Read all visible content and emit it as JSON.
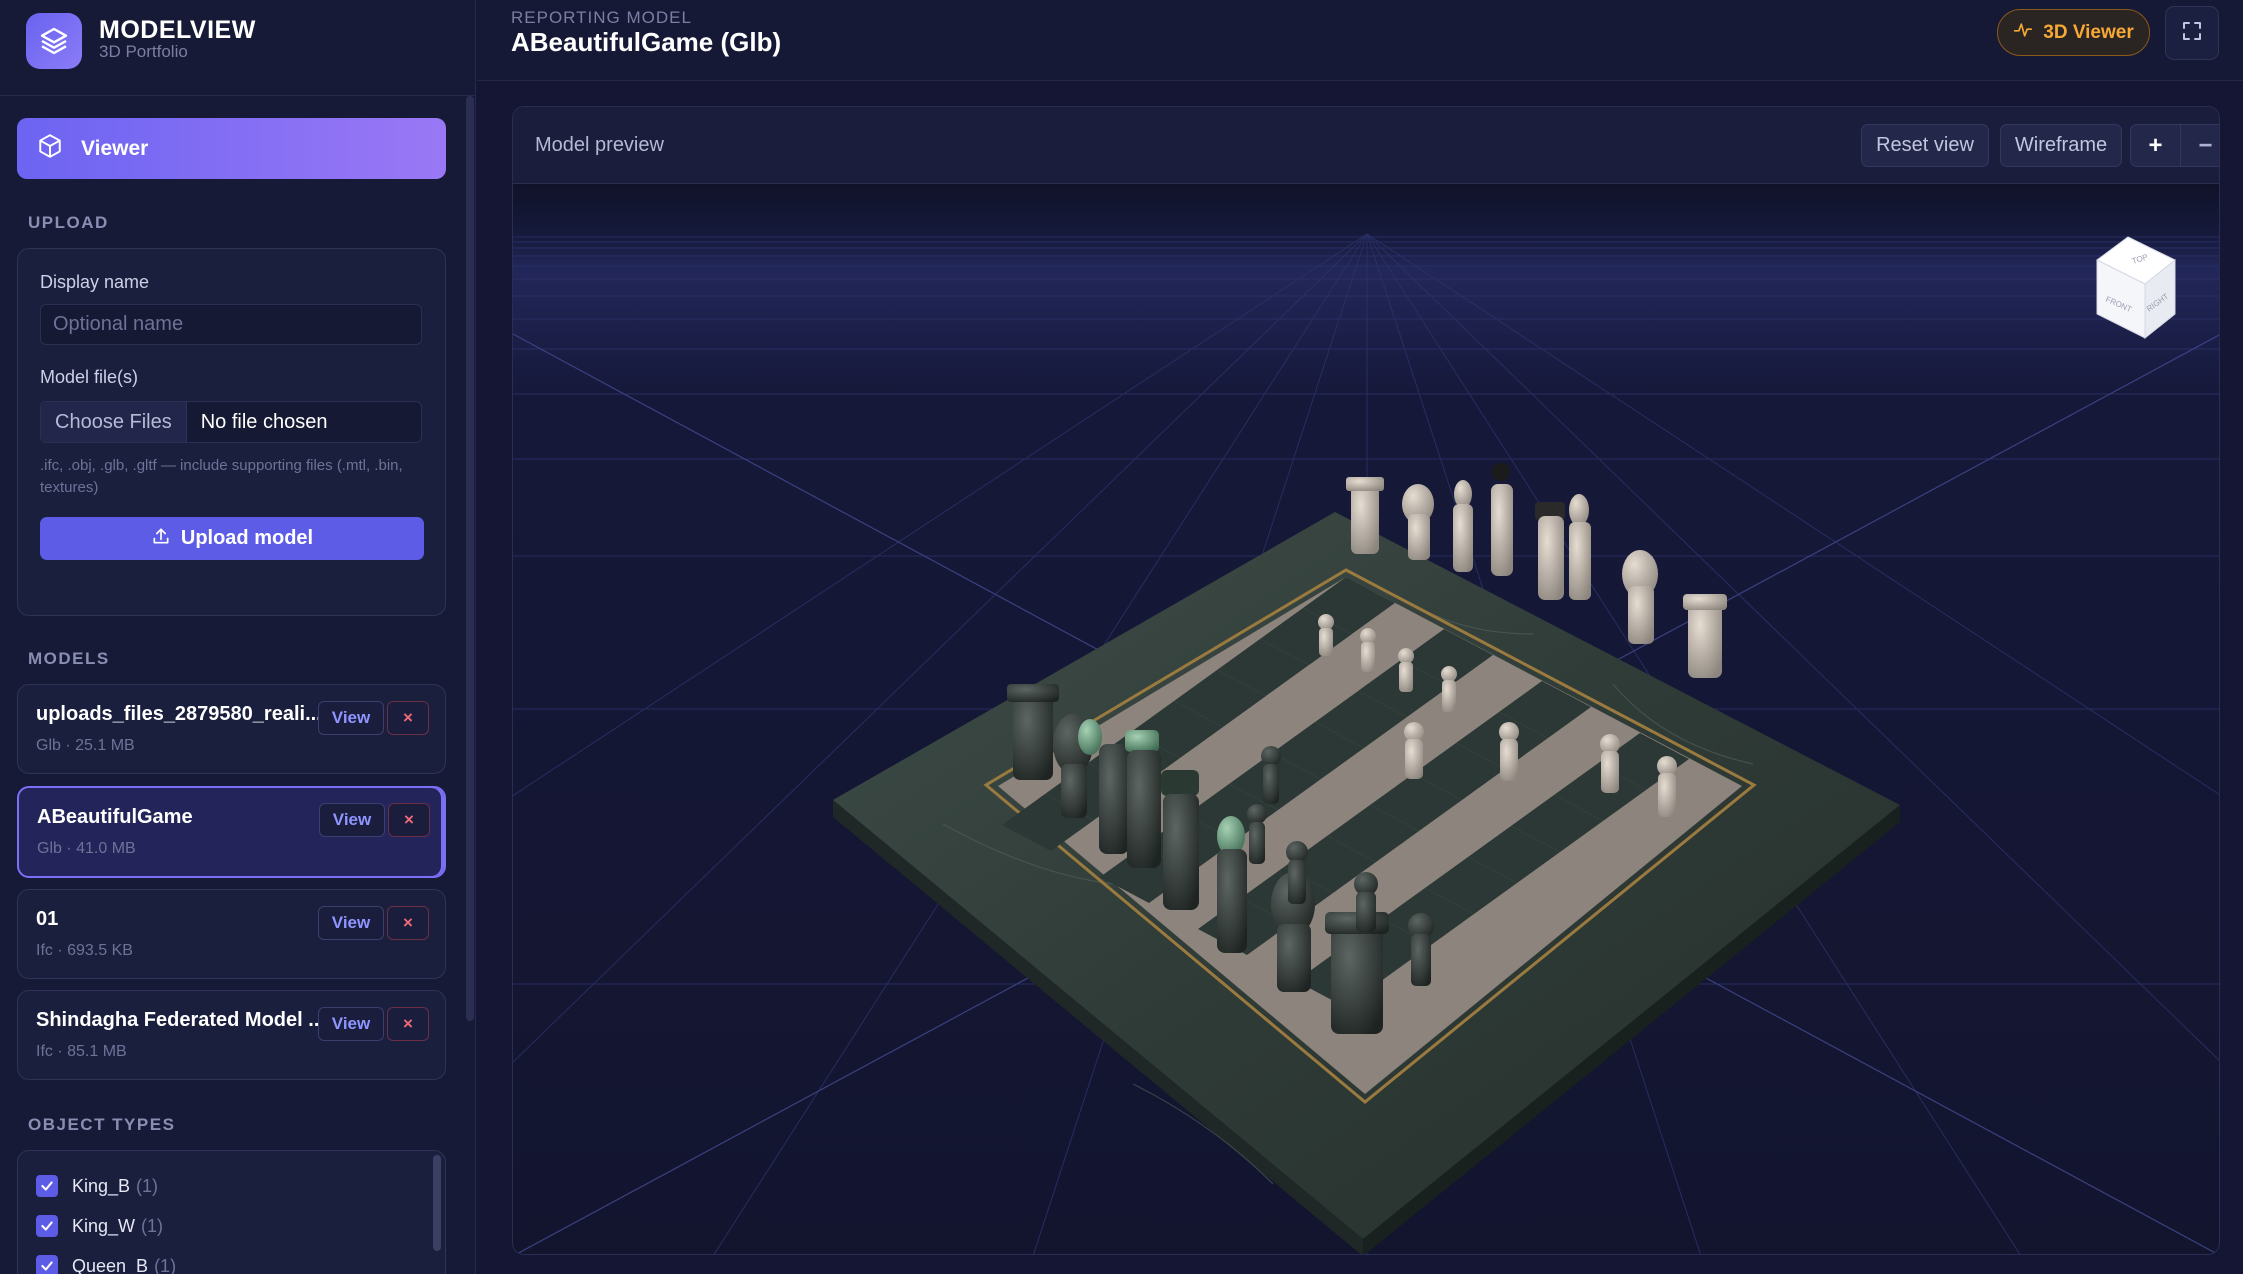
{
  "brand": {
    "title": "MODELVIEW",
    "subtitle": "3D Portfolio"
  },
  "nav": {
    "viewer_label": "Viewer"
  },
  "upload": {
    "section_label": "UPLOAD",
    "display_name_label": "Display name",
    "display_name_placeholder": "Optional name",
    "display_name_value": "",
    "files_label": "Model file(s)",
    "choose_files_label": "Choose Files",
    "no_file_text": "No file chosen",
    "hint": ".ifc, .obj, .glb, .gltf — include supporting files (.mtl, .bin, textures)",
    "upload_button_label": "Upload model"
  },
  "models": {
    "section_label": "MODELS",
    "view_label": "View",
    "delete_label": "×",
    "items": [
      {
        "name": "uploads_files_2879580_reali...",
        "meta": "Glb · 25.1 MB",
        "active": false
      },
      {
        "name": "ABeautifulGame",
        "meta": "Glb · 41.0 MB",
        "active": true
      },
      {
        "name": "01",
        "meta": "Ifc · 693.5 KB",
        "active": false
      },
      {
        "name": "Shindagha Federated Model ...",
        "meta": "Ifc · 85.1 MB",
        "active": false
      }
    ]
  },
  "object_types": {
    "section_label": "OBJECT TYPES",
    "items": [
      {
        "name": "King_B",
        "count": "(1)",
        "checked": true
      },
      {
        "name": "King_W",
        "count": "(1)",
        "checked": true
      },
      {
        "name": "Queen_B",
        "count": "(1)",
        "checked": true
      }
    ]
  },
  "header": {
    "kicker": "REPORTING MODEL",
    "title": "ABeautifulGame (Glb)",
    "badge_label": "3D Viewer"
  },
  "preview": {
    "title": "Model preview",
    "reset_label": "Reset view",
    "wireframe_label": "Wireframe",
    "zoom_in_label": "+",
    "zoom_out_label": "−",
    "viewcube": {
      "top": "TOP",
      "front": "FRONT",
      "right": "RIGHT"
    }
  },
  "colors": {
    "accent": "#6c64f2",
    "badge": "#f6a935",
    "danger": "#f06a7a",
    "background": "#141633"
  }
}
